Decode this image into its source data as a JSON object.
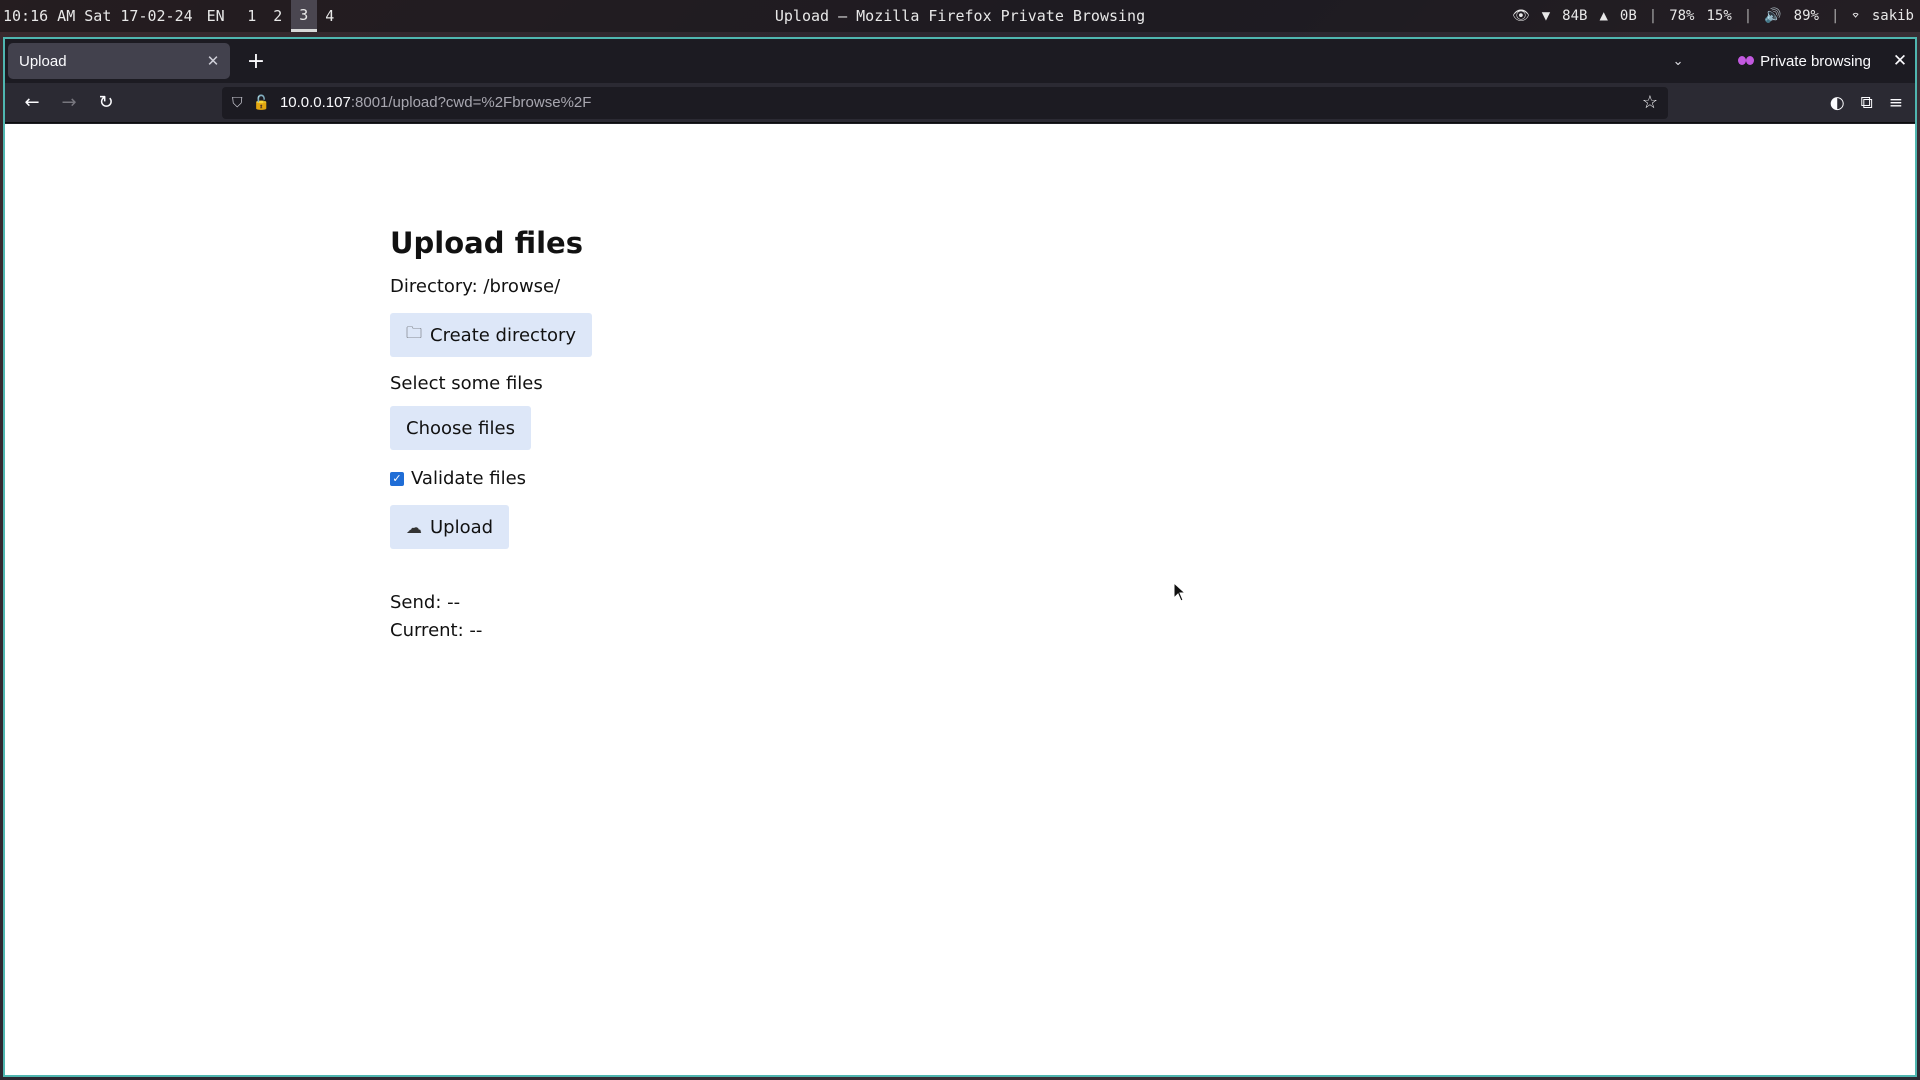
{
  "system_bar": {
    "clock": "10:16 AM Sat 17-02-24",
    "language": "EN",
    "workspaces": [
      "1",
      "2",
      "3",
      "4"
    ],
    "active_workspace": "3",
    "window_title": "Upload — Mozilla Firefox Private Browsing",
    "net_down": "84B",
    "net_up": "0B",
    "memory": "78%",
    "cpu": "15%",
    "volume": "89%",
    "user": "sakib"
  },
  "browser": {
    "tab_title": "Upload",
    "private_label": "Private browsing",
    "url_host": "10.0.0.107",
    "url_rest": ":8001/upload?cwd=%2Fbrowse%2F"
  },
  "page": {
    "title": "Upload files",
    "directory_line": "Directory: /browse/",
    "create_dir_label": "Create directory",
    "select_label": "Select some files",
    "choose_files_label": "Choose files",
    "validate_label": "Validate files",
    "validate_checked": true,
    "upload_label": "Upload",
    "send_line": "Send: --",
    "current_line": "Current: --"
  },
  "colors": {
    "button_bg": "#dde7f8",
    "checkbox": "#1f6dd6",
    "window_border": "#4fb6b0"
  }
}
